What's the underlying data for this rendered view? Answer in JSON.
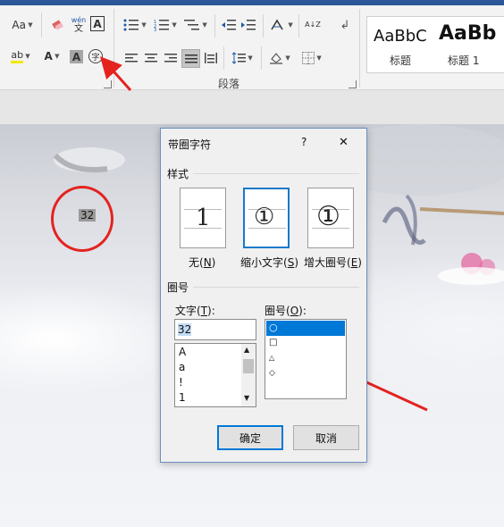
{
  "ribbon": {
    "aa_button": "Aa",
    "phonetic_top": "wén",
    "phonetic_bottom": "文",
    "char_border_label": "A",
    "font_color_label": "A",
    "char_shading_label": "A",
    "enclose_char_label": "字",
    "highlight_label": "ab",
    "sort_label": "A↓Z",
    "paragraph_group_label": "段落",
    "styles": [
      {
        "sample": "AaBbC",
        "name": "标题"
      },
      {
        "sample": "AaBb",
        "name": "标题 1"
      }
    ]
  },
  "document": {
    "selected_text": "32"
  },
  "dialog": {
    "title": "带圈字符",
    "help": "?",
    "close": "✕",
    "style_section": "样式",
    "style_options": [
      {
        "glyph": "1",
        "label": "无(",
        "key": "N",
        "end": ")"
      },
      {
        "glyph": "①",
        "label": "缩小文字(",
        "key": "S",
        "end": ")"
      },
      {
        "glyph": "①",
        "label": "增大圈号(",
        "key": "E",
        "end": ")"
      }
    ],
    "enclose_section": "圈号",
    "text_label": "文字(",
    "text_key": "T",
    "text_end": "):",
    "text_value": "32",
    "text_list": [
      "A",
      "a",
      "!",
      "1"
    ],
    "enclosure_label": "圈号(",
    "enclosure_key": "O",
    "enclosure_end": "):",
    "enclosure_list": [
      "○",
      "□",
      "△",
      "◇"
    ],
    "ok_label": "确定",
    "cancel_label": "取消"
  },
  "colors": {
    "accent": "#0078d7",
    "annotation_red": "#e4231f",
    "selection_blue": "#1979ca"
  }
}
